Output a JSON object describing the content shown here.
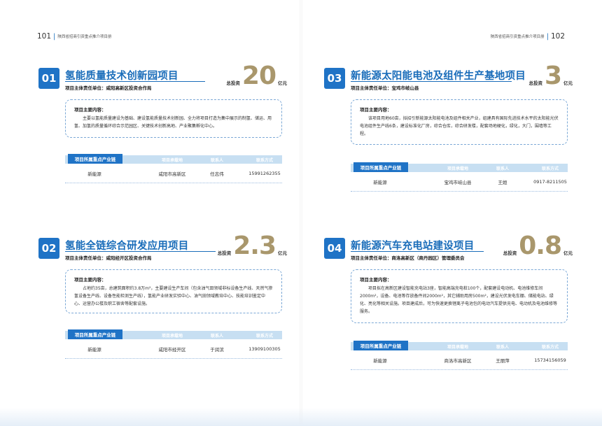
{
  "header": {
    "left_num": "101",
    "left_title": "陕西省招商引资重点推介项目册",
    "right_num": "102",
    "right_title": "陕西省招商引资重点推介项目册"
  },
  "labels": {
    "responsible_prefix": "项目主体责任单位：",
    "invest_label": "总投资",
    "invest_unit": "亿元",
    "desc_label": "项目主要内容：",
    "col_chain": "项目所属重点产业链",
    "col_site": "项目承载地",
    "col_contact": "联系人",
    "col_phone": "联系方式"
  },
  "projects": [
    {
      "number": "01",
      "title": "氢能质量技术创新园项目",
      "unit": "咸阳高新区投资合作局",
      "invest": "20",
      "desc": "主要以氢能质量建设为基础、建设氢能质量技术创新园、全力将项目打造为集中展示的制氢、储运、用氢、加氢的质量循环综合示范园区、关键技术创新高地、产业聚集孵化中心。",
      "chain": "新能源",
      "site": "咸阳市高新区",
      "contact": "任志伟",
      "phone": "15991262355"
    },
    {
      "number": "02",
      "title": "氢能全链综合研发应用项目",
      "unit": "咸阳经开区投资合作局",
      "invest": "2.3",
      "desc": "占地约35亩，总建筑面积约3.8万m²，主要建设生产车间（包含油气田领域非标设备生产线、天然气掺氢设备生产线、设备性能检测生产线），氢能产业研发实验中心、油气田领域教培中心、技能培训鉴定中心、运营办公楼及职工宿舍等配套设施。",
      "chain": "新能源",
      "site": "咸阳市经开区",
      "contact": "于润滨",
      "phone": "13909100305"
    },
    {
      "number": "03",
      "title": "新能源太阳能电池及组件生产基地项目",
      "unit": "宝鸡市岐山县",
      "invest": "3",
      "desc": "该项目用地60亩，拟招引新能源太阳能电池及组件相关产业，组建具有国际先进技术水平的太阳能光伏电池组件生产线6条，建设标准化厂房，综合仓库，综合研发楼，配套场地硬化，绿化，大门，围墙等工程。",
      "chain": "新能源",
      "site": "宝鸡市岐山县",
      "contact": "王姮",
      "phone": "0917-8211505"
    },
    {
      "number": "04",
      "title": "新能源汽车充电站建设项目",
      "unit": "商洛高新区（商丹园区）管理委员会",
      "invest": "0.8",
      "desc": "项目拟在高新区建设智能充电站3座，智能高端充电桩100个，配套建设电动机、电池维修车间2000m²，设备、电池等存放备件间2000m²，其它辅助用房500m²，建设光伏发电车棚、储能电站、绿化、亮化等相关设施。项目建成后，可为快速更换锂离子电池包的电动汽车提供充电、电动机及电池维修等服务。",
      "chain": "新能源",
      "site": "商洛市高新区",
      "contact": "王丽萍",
      "phone": "15734156059"
    }
  ]
}
